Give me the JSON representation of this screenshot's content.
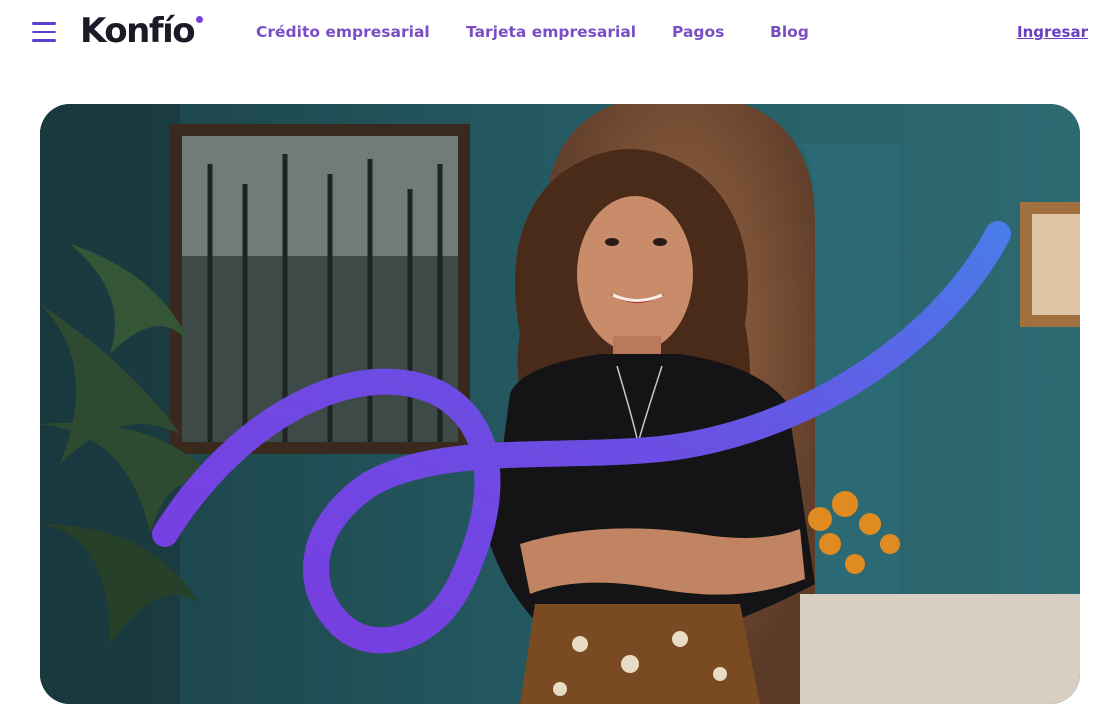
{
  "header": {
    "logo_text": "Konfío",
    "nav": [
      {
        "label": "Crédito empresarial"
      },
      {
        "label": "Tarjeta empresarial"
      },
      {
        "label": "Pagos"
      },
      {
        "label": "Blog"
      }
    ],
    "login_label": "Ingresar"
  },
  "colors": {
    "brand_purple": "#7a4fc6",
    "logo_dot": "#7b3fd9",
    "stroke_purple": "#7a3be0",
    "stroke_blue": "#4a7be9"
  },
  "icons": {
    "menu": "hamburger-icon"
  }
}
